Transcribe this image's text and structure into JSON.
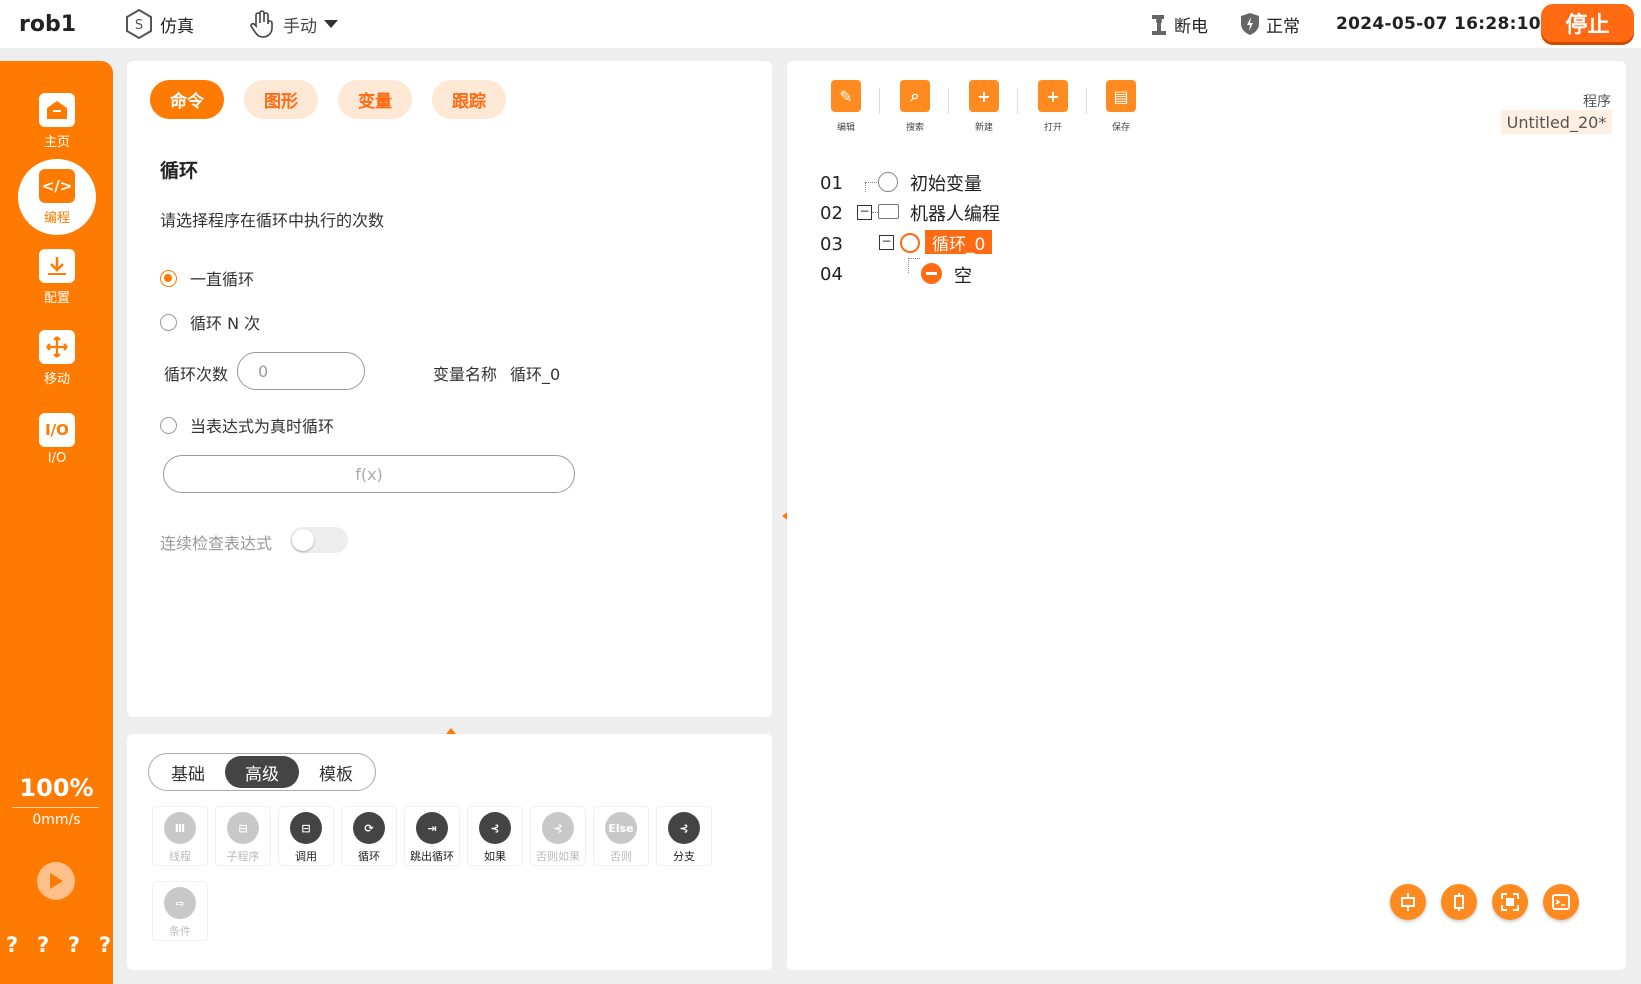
{
  "topbar": {
    "robot_name": "rob1",
    "mode_sim": "仿真",
    "mode_manual": "手动",
    "power_status": "断电",
    "safety_status": "正常",
    "datetime": "2024-05-07 16:28:10",
    "stop_label": "停止"
  },
  "sidebar": {
    "items": [
      {
        "label": "主页",
        "icon": "home-icon"
      },
      {
        "label": "编程",
        "icon": "code-icon",
        "active": true
      },
      {
        "label": "配置",
        "icon": "download-config-icon"
      },
      {
        "label": "移动",
        "icon": "move-arrows-icon"
      },
      {
        "label": "I/O",
        "icon": "io-icon"
      }
    ],
    "io_glyph": "I/O",
    "speed_percent": "100%",
    "speed_mms": "0mm/s",
    "question_marks": [
      "?",
      "?",
      "?",
      "?"
    ]
  },
  "command_panel": {
    "tabs": [
      "命令",
      "图形",
      "变量",
      "跟踪"
    ],
    "active_tab": "命令",
    "title": "循环",
    "description": "请选择程序在循环中执行的次数",
    "options": [
      {
        "label": "一直循环",
        "selected": true
      },
      {
        "label": "循环 N 次",
        "selected": false
      },
      {
        "label": "当表达式为真时循环",
        "selected": false
      }
    ],
    "count_label": "循环次数",
    "count_value": "0",
    "var_name_label": "变量名称",
    "var_name_value": "循环_0",
    "expression_placeholder": "f(x)",
    "continuous_check_label": "连续检查表达式",
    "continuous_check_on": false
  },
  "tool_panel": {
    "segments": [
      "基础",
      "高级",
      "模板"
    ],
    "active_segment": "高级",
    "tools": [
      {
        "label": "线程",
        "glyph": "Ⅲ",
        "enabled": false
      },
      {
        "label": "子程序",
        "glyph": "⊟",
        "enabled": false
      },
      {
        "label": "调用",
        "glyph": "⊟",
        "enabled": true
      },
      {
        "label": "循环",
        "glyph": "⟳",
        "enabled": true
      },
      {
        "label": "跳出循环",
        "glyph": "⇥",
        "enabled": true
      },
      {
        "label": "如果",
        "glyph": "⊰",
        "enabled": true
      },
      {
        "label": "否则如果",
        "glyph": "⊰",
        "enabled": false
      },
      {
        "label": "否则",
        "glyph": "Else",
        "enabled": false
      },
      {
        "label": "分支",
        "glyph": "⊰",
        "enabled": true
      },
      {
        "label": "条件",
        "glyph": "⇨",
        "enabled": false
      }
    ]
  },
  "program_panel": {
    "toolbar": [
      {
        "label": "编辑",
        "glyph": "✎"
      },
      {
        "label": "搜索",
        "glyph": "⌕"
      },
      {
        "label": "新建",
        "glyph": "+"
      },
      {
        "label": "打开",
        "glyph": "+"
      },
      {
        "label": "保存",
        "glyph": "▤"
      }
    ],
    "program_label": "程序",
    "program_name": "Untitled_20*",
    "tree": [
      {
        "line": "01",
        "text": "初始变量"
      },
      {
        "line": "02",
        "text": "机器人编程"
      },
      {
        "line": "03",
        "text": "循环_0"
      },
      {
        "line": "04",
        "text": "空"
      }
    ],
    "bottom_buttons": [
      "expand-horizontal-icon",
      "expand-vertical-icon",
      "fit-screen-icon",
      "console-icon"
    ]
  },
  "colors": {
    "accent": "#ff7a00",
    "stop": "#ff6a13",
    "tab_inactive_bg": "#fde8d6"
  }
}
